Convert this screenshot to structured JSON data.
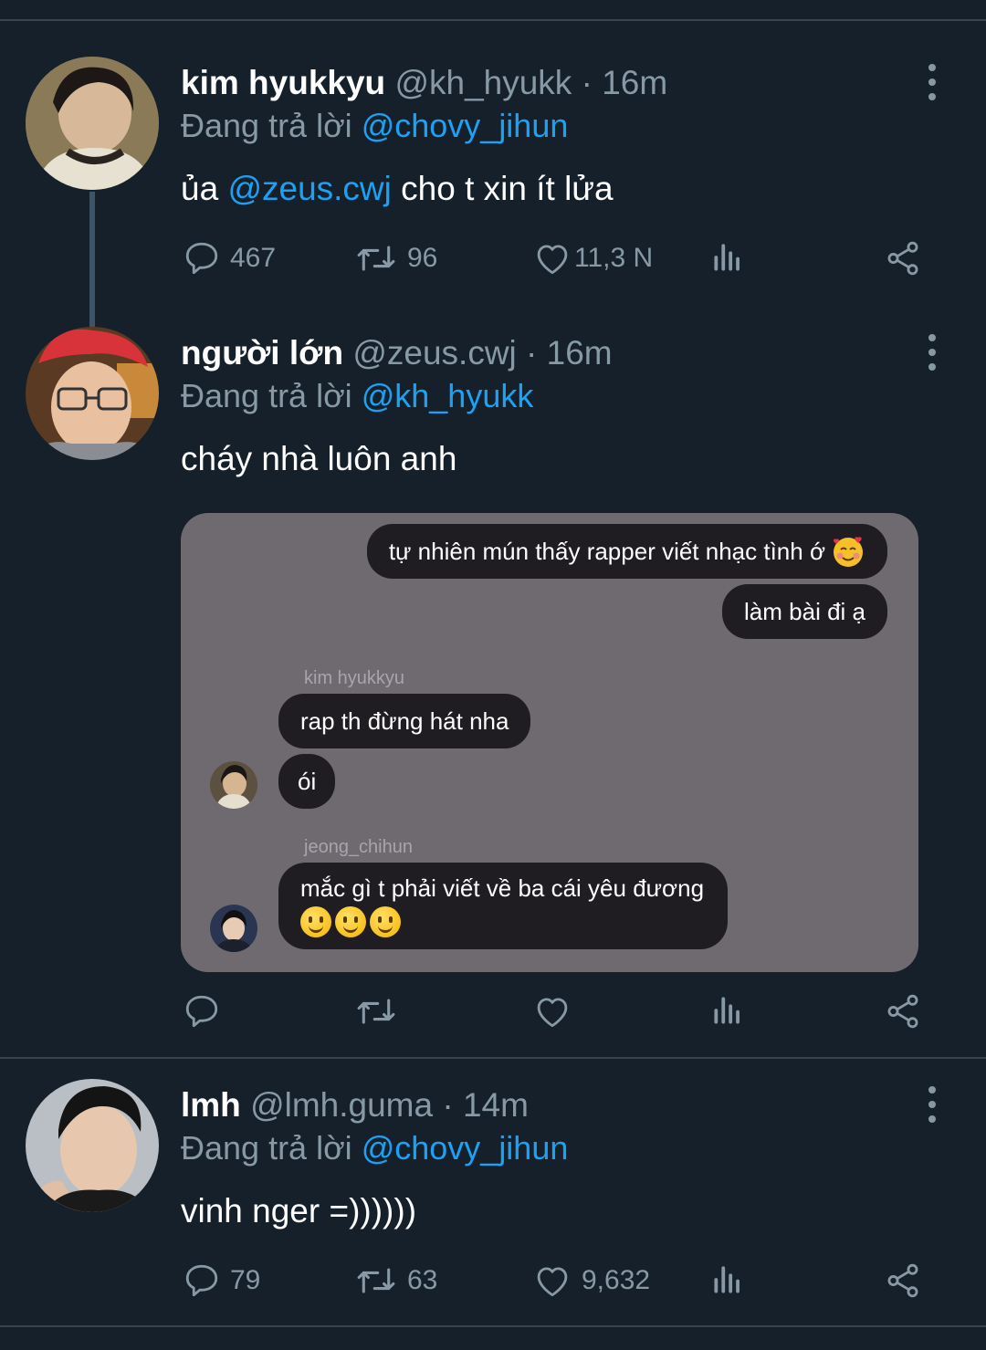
{
  "tweets": [
    {
      "name": "kim hyukkyu",
      "handle": "@kh_hyukk",
      "time": "16m",
      "replying_prefix": "Đang trả lời",
      "replying_to": "@chovy_jihun",
      "text_before": "ủa",
      "text_mention": "@zeus.cwj",
      "text_after": "cho t xin ít lửa",
      "replies": "467",
      "retweets": "96",
      "likes": "11,3 N"
    },
    {
      "name": "người lớn",
      "handle": "@zeus.cwj",
      "time": "16m",
      "replying_prefix": "Đang trả lời",
      "replying_to": "@kh_hyukk",
      "text": "cháy nhà luôn anh",
      "media": {
        "msg1": "tự nhiên mún thấy rapper viết nhạc tình ớ",
        "msg2": "làm bài đi ạ",
        "sender1": "kim hyukkyu",
        "msg3": "rap th đừng hát nha",
        "msg4": "ói",
        "sender2": "jeong_chihun",
        "msg5": "mắc gì t phải viết về ba cái yêu đương"
      }
    },
    {
      "name": "lmh",
      "handle": "@lmh.guma",
      "time": "14m",
      "replying_prefix": "Đang trả lời",
      "replying_to": "@chovy_jihun",
      "text": "vinh nger =))))))",
      "replies": "79",
      "retweets": "63",
      "likes": "9,632"
    }
  ],
  "colors": {
    "background": "#15202b",
    "divider": "#38444d",
    "muted": "#8899a6",
    "accent": "#1da1f2",
    "media_bg": "#6f6a70",
    "bubble": "#1f1d22"
  },
  "icons": [
    "more-icon",
    "reply-icon",
    "retweet-icon",
    "like-icon",
    "analytics-icon",
    "share-icon",
    "smiling-face-with-hearts-emoji",
    "smiling-face-emoji"
  ]
}
